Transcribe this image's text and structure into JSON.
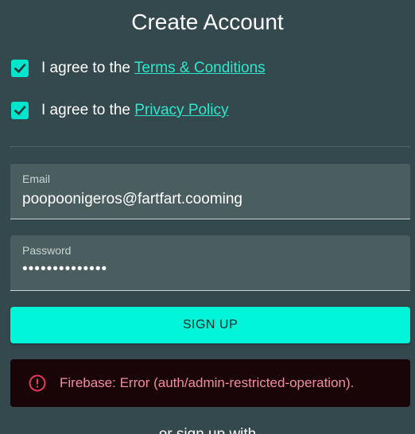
{
  "page": {
    "title": "Create Account"
  },
  "agreements": {
    "terms_prefix": "I agree to the ",
    "terms_link": "Terms & Conditions",
    "privacy_prefix": "I agree to the ",
    "privacy_link": "Privacy Policy",
    "terms_checked": true,
    "privacy_checked": true
  },
  "form": {
    "email_label": "Email",
    "email_value": "poopoonigeros@fartfart.cooming",
    "password_label": "Password",
    "password_value": "••••••••••••••",
    "signup_label": "SIGN UP"
  },
  "error": {
    "icon": "error-circle-icon",
    "message": "Firebase: Error (auth/admin-restricted-operation)."
  },
  "alternate": {
    "text": "or sign up with"
  },
  "colors": {
    "background": "#34494d",
    "accent": "#00f5d8",
    "link": "#2ee6cd",
    "error_bg": "#190508",
    "error_text": "#f48aa2"
  }
}
